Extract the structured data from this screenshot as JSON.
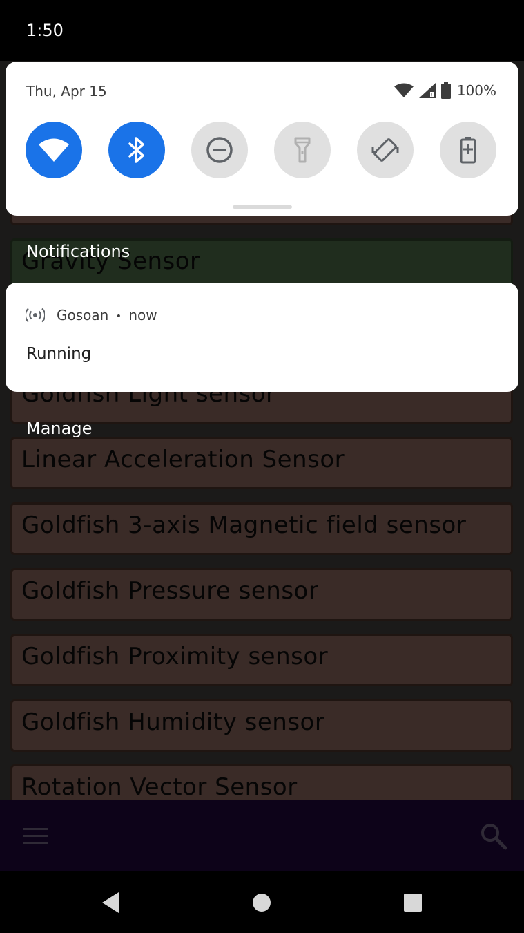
{
  "status_bar": {
    "time": "1:50"
  },
  "quick_settings": {
    "date": "Thu, Apr 15",
    "battery_percent": "100%",
    "tiles": [
      {
        "name": "wifi",
        "state": "on"
      },
      {
        "name": "bluetooth",
        "state": "on"
      },
      {
        "name": "do-not-disturb",
        "state": "off"
      },
      {
        "name": "flashlight",
        "state": "off"
      },
      {
        "name": "auto-rotate",
        "state": "off"
      },
      {
        "name": "battery-saver",
        "state": "off"
      }
    ]
  },
  "notifications": {
    "header": "Notifications",
    "items": [
      {
        "app": "Gosoan",
        "separator": "•",
        "time": "now",
        "title": "Running"
      }
    ],
    "manage_label": "Manage"
  },
  "background_app": {
    "sensors": [
      "Gravity Sensor",
      "Goldfish Light sensor",
      "Linear Acceleration Sensor",
      "Goldfish 3-axis Magnetic field sensor",
      "Goldfish Pressure sensor",
      "Goldfish Proximity sensor",
      "Goldfish Humidity sensor",
      "Rotation Vector Sensor"
    ]
  },
  "colors": {
    "tile_on": "#1a73e8",
    "tile_off": "#e0e0e0",
    "bottom_bar": "#0d0319"
  }
}
